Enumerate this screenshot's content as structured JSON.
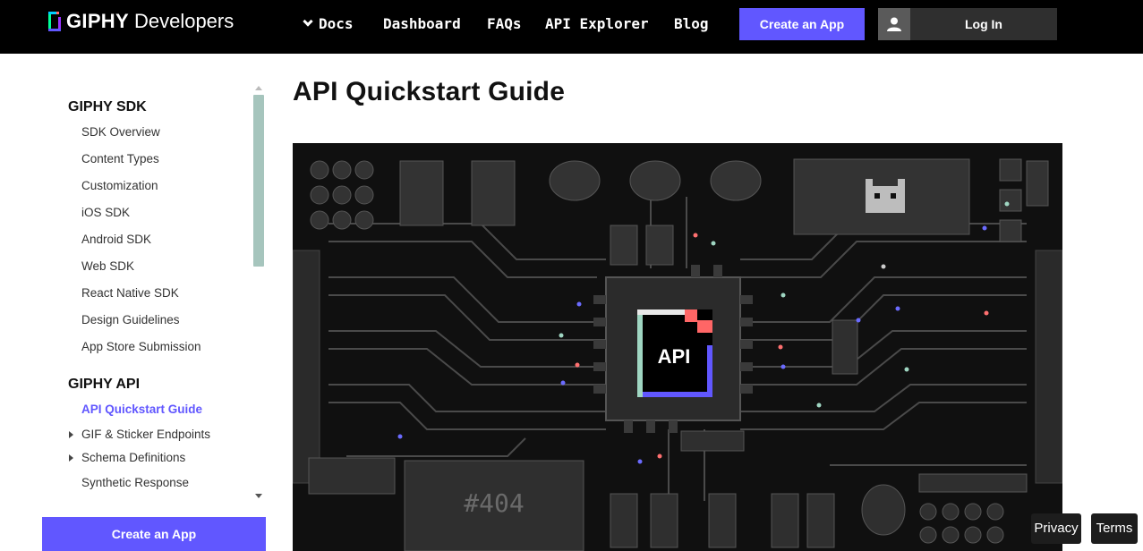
{
  "header": {
    "logo_text": "GIPHY",
    "logo_sub": "Developers",
    "nav": {
      "docs": "Docs",
      "dashboard": "Dashboard",
      "faqs": "FAQs",
      "api_explorer": "API Explorer",
      "blog": "Blog"
    },
    "create_app": "Create an App",
    "login": "Log In"
  },
  "sidebar": {
    "sdk_title": "GIPHY SDK",
    "sdk_items": [
      "SDK Overview",
      "Content Types",
      "Customization",
      "iOS SDK",
      "Android SDK",
      "Web SDK",
      "React Native SDK",
      "Design Guidelines",
      "App Store Submission"
    ],
    "api_title": "GIPHY API",
    "api_items": [
      "API Quickstart Guide",
      "GIF & Sticker Endpoints",
      "Schema Definitions",
      "Synthetic Response"
    ],
    "active_item": "API Quickstart Guide",
    "create_app": "Create an App"
  },
  "main": {
    "title": "API Quickstart Guide",
    "hero_label": "API",
    "hero_screen_text": "#404"
  },
  "footer": {
    "privacy": "Privacy",
    "terms": "Terms"
  },
  "colors": {
    "accent": "#6157ff",
    "topbar": "#000000",
    "hero_bg": "#111111"
  }
}
